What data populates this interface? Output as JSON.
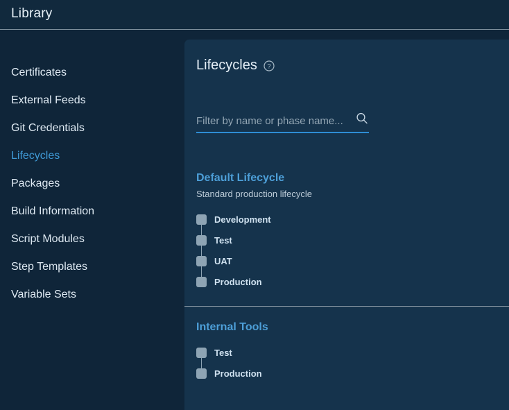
{
  "header": {
    "title": "Library"
  },
  "sidebar": {
    "items": [
      {
        "label": "Certificates",
        "active": false
      },
      {
        "label": "External Feeds",
        "active": false
      },
      {
        "label": "Git Credentials",
        "active": false
      },
      {
        "label": "Lifecycles",
        "active": true
      },
      {
        "label": "Packages",
        "active": false
      },
      {
        "label": "Build Information",
        "active": false
      },
      {
        "label": "Script Modules",
        "active": false
      },
      {
        "label": "Step Templates",
        "active": false
      },
      {
        "label": "Variable Sets",
        "active": false
      }
    ]
  },
  "main": {
    "title": "Lifecycles",
    "help_icon": "help-circle-icon",
    "filter": {
      "placeholder": "Filter by name or phase name...",
      "value": "",
      "icon": "search-icon"
    },
    "lifecycles": [
      {
        "name": "Default Lifecycle",
        "description": "Standard production lifecycle",
        "phases": [
          "Development",
          "Test",
          "UAT",
          "Production"
        ]
      },
      {
        "name": "Internal Tools",
        "description": "",
        "phases": [
          "Test",
          "Production"
        ]
      }
    ]
  },
  "colors": {
    "page_background": "#0f2539",
    "header_background": "#11293d",
    "panel_background": "#15334c",
    "accent": "#3f9ad6",
    "link": "#4d9fd8",
    "underline": "#2e8dd4",
    "marker": "#8ea4b4",
    "divider": "#8c9aa5",
    "text_primary": "#e6f0f8",
    "text_muted": "#93a6b4"
  }
}
